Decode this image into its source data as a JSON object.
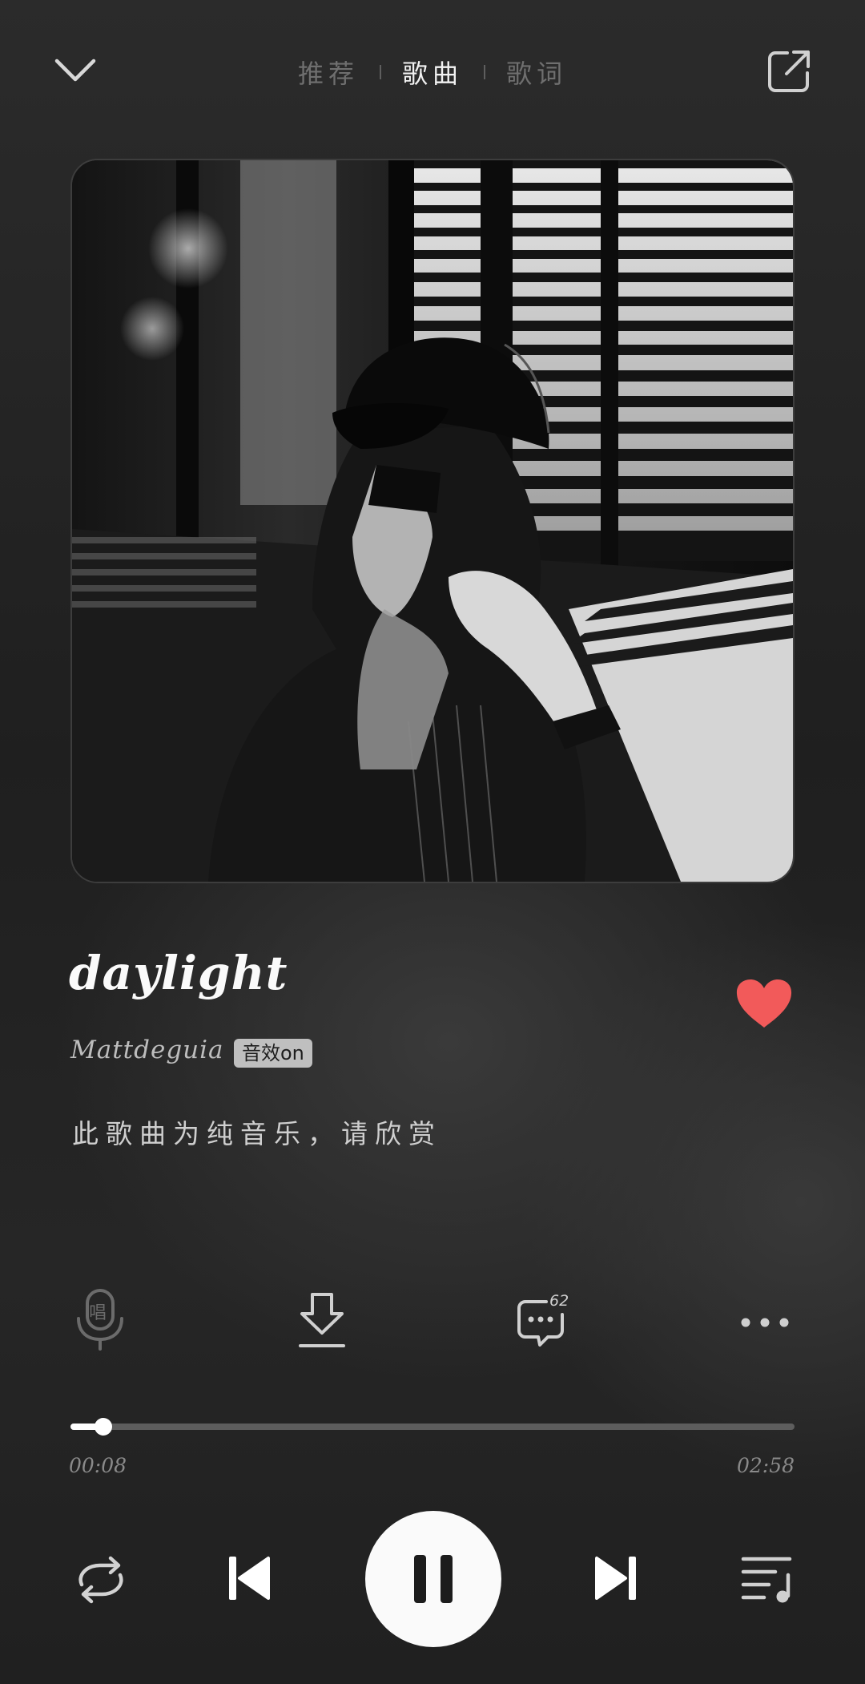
{
  "topbar": {
    "tabs": [
      {
        "label": "推荐",
        "active": false
      },
      {
        "label": "歌曲",
        "active": true
      },
      {
        "label": "歌词",
        "active": false
      }
    ],
    "collapse_icon": "chevron-down-icon",
    "share_icon": "share-external-icon"
  },
  "song": {
    "title": "daylight",
    "artist": "Mattdeguia",
    "effect_badge": "音效on",
    "lyric_note": "此歌曲为纯音乐，请欣赏",
    "liked": true,
    "like_color": "#f25a5a"
  },
  "actions": {
    "sing_icon_label": "唱",
    "comment_count": "62",
    "icons": [
      "karaoke-mic-icon",
      "download-icon",
      "comment-icon",
      "more-icon"
    ]
  },
  "progress": {
    "current": "00:08",
    "duration": "02:58",
    "fraction": 0.045
  },
  "controls": {
    "state": "playing",
    "icons": [
      "repeat-icon",
      "previous-icon",
      "pause-icon",
      "next-icon",
      "playlist-icon"
    ]
  }
}
